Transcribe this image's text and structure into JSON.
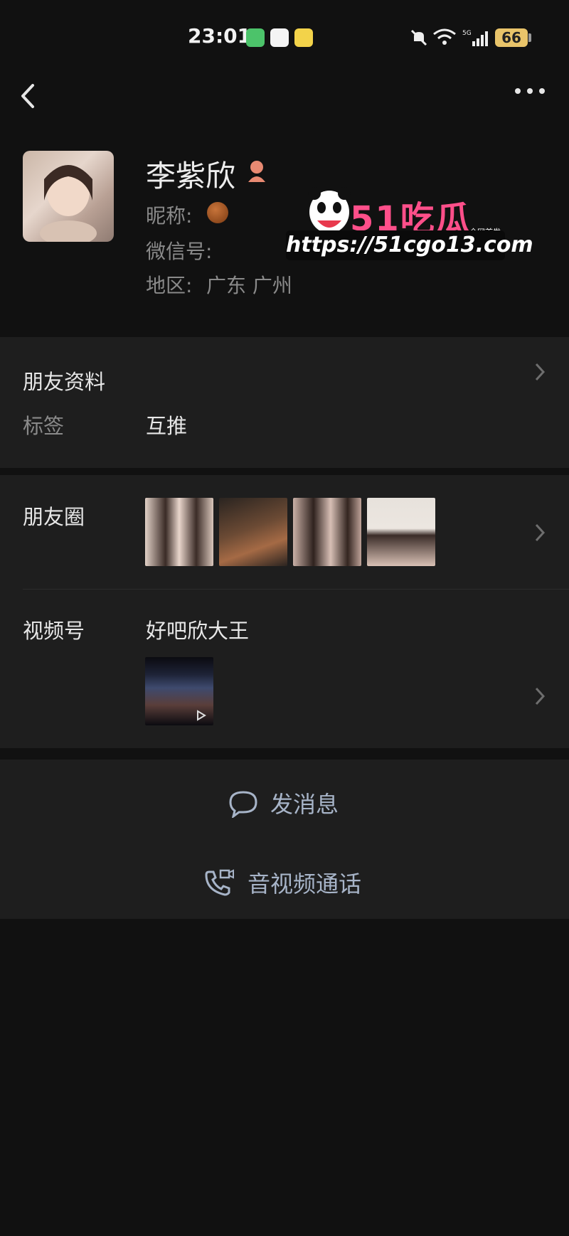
{
  "status_bar": {
    "time": "23:01",
    "battery": "66",
    "icons": [
      "wechat-icon",
      "app-icon",
      "qr-app-icon",
      "mute-icon",
      "wifi-icon",
      "signal-5g-icon"
    ]
  },
  "profile": {
    "name": "李紫欣",
    "nickname_label": "昵称:",
    "wechat_id_label": "微信号:",
    "region_label": "地区:",
    "region_value": "广东  广州"
  },
  "watermark": {
    "brand": "51吃瓜",
    "tag": "全网首发",
    "url": "https://51cgo13.com"
  },
  "friend_info": {
    "title": "朋友资料",
    "tags_label": "标签",
    "tags_value": "互推"
  },
  "moments": {
    "label": "朋友圈"
  },
  "channels": {
    "label": "视频号",
    "name": "好吧欣大王"
  },
  "actions": {
    "message": "发消息",
    "call": "音视频通话"
  },
  "colors": {
    "background": "#111111",
    "card": "#1e1e1e",
    "action_text": "#a7b4c8",
    "battery": "#e9c46a"
  }
}
